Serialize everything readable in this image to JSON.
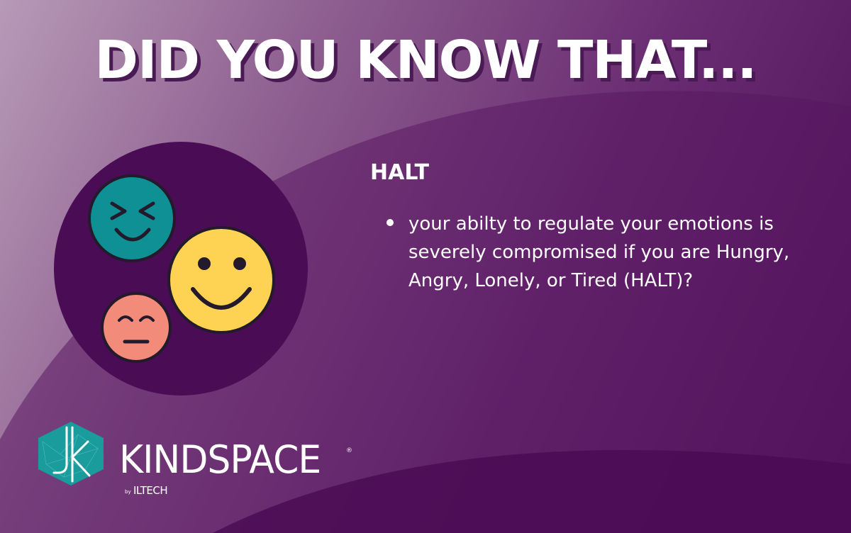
{
  "headline": "DID YOU KNOW THAT...",
  "topic": {
    "title": "HALT",
    "bullets": [
      "your abilty to regulate your emotions is severely compromised if you are Hungry, Angry, Lonely, or Tired (HALT)?"
    ]
  },
  "brand": {
    "name": "KINDSPACE",
    "registered": "®",
    "by": "by",
    "company": "ILTECH",
    "logo_monogram": "JK"
  },
  "icons": [
    "squinting-face-icon",
    "smiling-face-icon",
    "neutral-face-icon"
  ],
  "colors": {
    "background_light": "#b79ab7",
    "background_dark": "#4b0c55",
    "disc": "#4a0d55",
    "teal_face": "#0f9095",
    "yellow_face": "#fed354",
    "salmon_face": "#f38b7b",
    "logo_teal": "#1a9b9c"
  }
}
